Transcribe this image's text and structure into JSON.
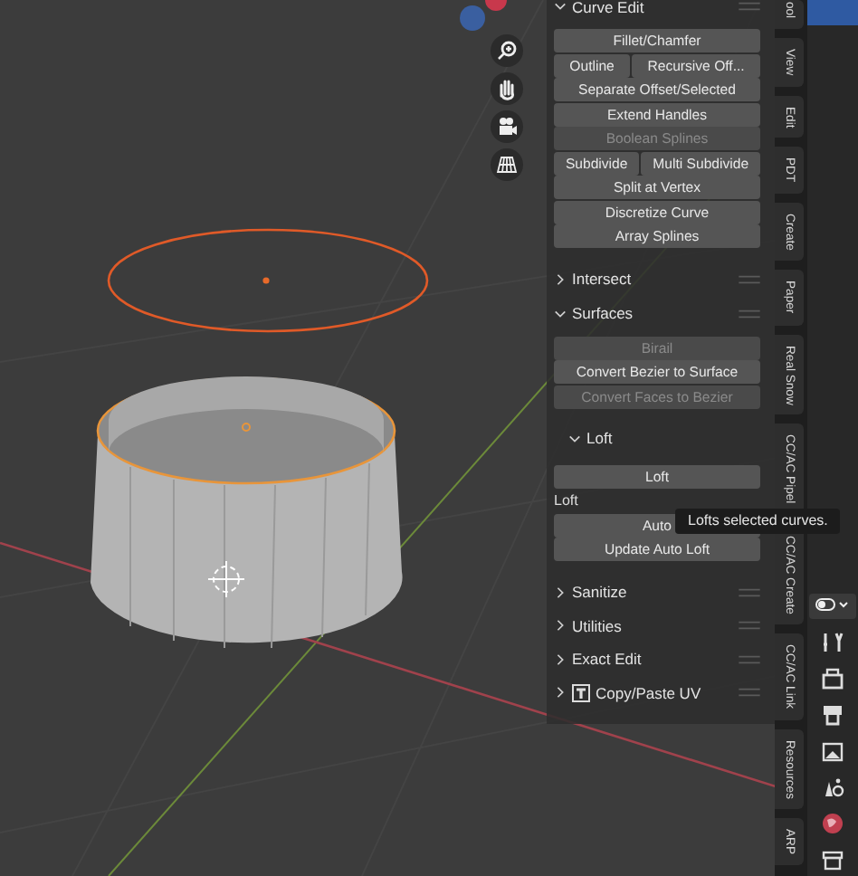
{
  "panel": {
    "sections": [
      {
        "title": "Curve Edit",
        "kind": "panel",
        "expanded": true,
        "items": [
          {
            "kind": "buttons",
            "buttons": [
              {
                "label": "Fillet/Chamfer",
                "disabled": false
              }
            ]
          },
          {
            "kind": "buttons",
            "buttons": [
              {
                "label": "Outline",
                "disabled": false
              },
              {
                "label": "Recursive Off...",
                "disabled": false
              }
            ]
          },
          {
            "kind": "buttons",
            "buttons": [
              {
                "label": "Separate Offset/Selected",
                "disabled": false
              }
            ]
          },
          {
            "kind": "buttons",
            "buttons": [
              {
                "label": "Extend Handles",
                "disabled": false
              }
            ]
          },
          {
            "kind": "buttons",
            "buttons": [
              {
                "label": "Boolean Splines",
                "disabled": true
              }
            ]
          },
          {
            "kind": "buttons",
            "buttons": [
              {
                "label": "Subdivide",
                "disabled": false
              },
              {
                "label": "Multi Subdivide",
                "disabled": false
              }
            ]
          },
          {
            "kind": "buttons",
            "buttons": [
              {
                "label": "Split at Vertex",
                "disabled": false
              }
            ]
          },
          {
            "kind": "buttons",
            "buttons": [
              {
                "label": "Discretize Curve",
                "disabled": false
              }
            ]
          },
          {
            "kind": "buttons",
            "buttons": [
              {
                "label": "Array Splines",
                "disabled": false
              }
            ]
          }
        ]
      },
      {
        "title": "Intersect",
        "kind": "panel",
        "expanded": false
      },
      {
        "title": "Surfaces",
        "kind": "panel",
        "expanded": true,
        "items": [
          {
            "kind": "buttons",
            "buttons": [
              {
                "label": "Birail",
                "disabled": true
              }
            ]
          },
          {
            "kind": "buttons",
            "buttons": [
              {
                "label": "Convert Bezier to Surface",
                "disabled": false
              }
            ]
          },
          {
            "kind": "buttons",
            "buttons": [
              {
                "label": "Convert Faces to Bezier",
                "disabled": true
              }
            ]
          },
          {
            "kind": "subpanel",
            "title": "Loft",
            "expanded": true,
            "items": [
              {
                "kind": "buttons",
                "buttons": [
                  {
                    "label": "Loft",
                    "disabled": false
                  }
                ]
              },
              {
                "kind": "label",
                "text": "Loft"
              },
              {
                "kind": "buttons",
                "buttons": [
                  {
                    "label": "Auto",
                    "disabled": false
                  }
                ]
              },
              {
                "kind": "buttons",
                "buttons": [
                  {
                    "label": "Update Auto Loft",
                    "disabled": false
                  }
                ]
              }
            ]
          }
        ]
      },
      {
        "title": "Sanitize",
        "kind": "panel",
        "expanded": false
      },
      {
        "title": "Utilities",
        "kind": "panel",
        "expanded": false
      },
      {
        "title": "Exact Edit",
        "kind": "panel",
        "expanded": false
      },
      {
        "title": "Copy/Paste UV",
        "kind": "addon-panel",
        "expanded": false
      }
    ]
  },
  "tooltip": {
    "text": "Lofts selected curves."
  },
  "tabs": [
    {
      "label": "ool"
    },
    {
      "label": "View"
    },
    {
      "label": "Edit"
    },
    {
      "label": "PDT"
    },
    {
      "label": "Create"
    },
    {
      "label": "Paper"
    },
    {
      "label": "Real Snow"
    },
    {
      "label": "CC/AC Pipel"
    },
    {
      "label": "CC/AC Create"
    },
    {
      "label": "CC/AC Link"
    },
    {
      "label": "Resources"
    },
    {
      "label": "ARP"
    }
  ]
}
